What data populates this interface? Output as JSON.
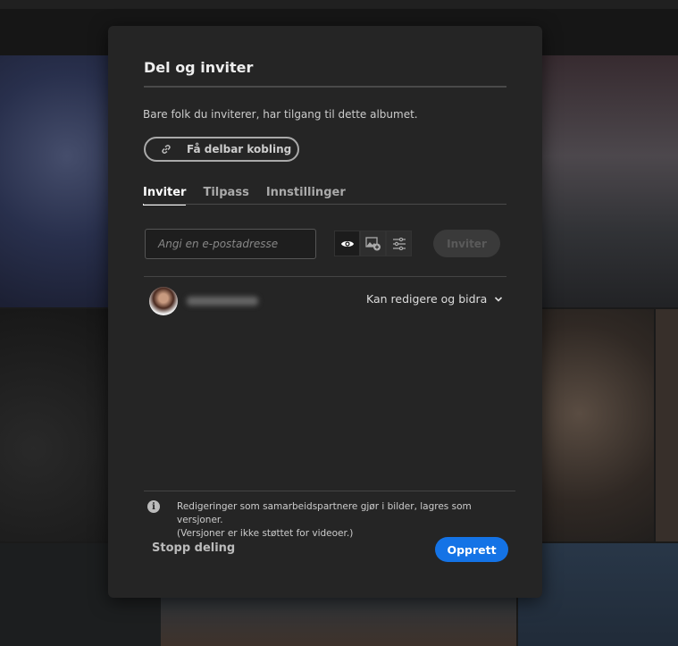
{
  "dialog": {
    "title": "Del og inviter",
    "description": "Bare folk du inviterer, har tilgang til dette albumet.",
    "share_link_label": "Få delbar kobling",
    "tabs": [
      {
        "label": "Inviter",
        "active": true
      },
      {
        "label": "Tilpass",
        "active": false
      },
      {
        "label": "Innstillinger",
        "active": false
      }
    ],
    "email_placeholder": "Angi en e-postadresse",
    "invite_label": "Inviter",
    "member": {
      "permission": "Kan redigere og bidra"
    },
    "info_note_line1": "Redigeringer som samarbeidspartnere gjør i bilder, lagres som versjoner.",
    "info_note_line2": "(Versjoner er ikke støttet for videoer.)",
    "stop_sharing_label": "Stopp deling",
    "create_label": "Opprett"
  },
  "colors": {
    "accent": "#1473e6",
    "dialog_bg": "#252525"
  }
}
